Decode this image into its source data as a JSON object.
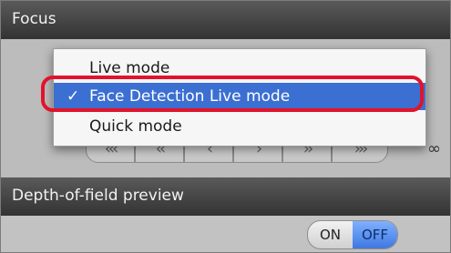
{
  "focus": {
    "header_title": "Focus",
    "menu": {
      "items": [
        {
          "label": "Live mode",
          "checked": false
        },
        {
          "label": "Face Detection Live mode",
          "checked": true
        },
        {
          "label": "Quick mode",
          "checked": false
        }
      ],
      "check_glyph": "✓",
      "highlight_color": "#3b6fd2",
      "annotation_ring_color": "#e2132a"
    },
    "nav_buttons": [
      "‹‹‹",
      "‹‹",
      "‹",
      "›",
      "››",
      "›››"
    ],
    "infinity_symbol": "∞"
  },
  "depth_of_field": {
    "header_title": "Depth-of-field preview",
    "toggle": {
      "on_label": "ON",
      "off_label": "OFF",
      "selected": "OFF"
    }
  }
}
